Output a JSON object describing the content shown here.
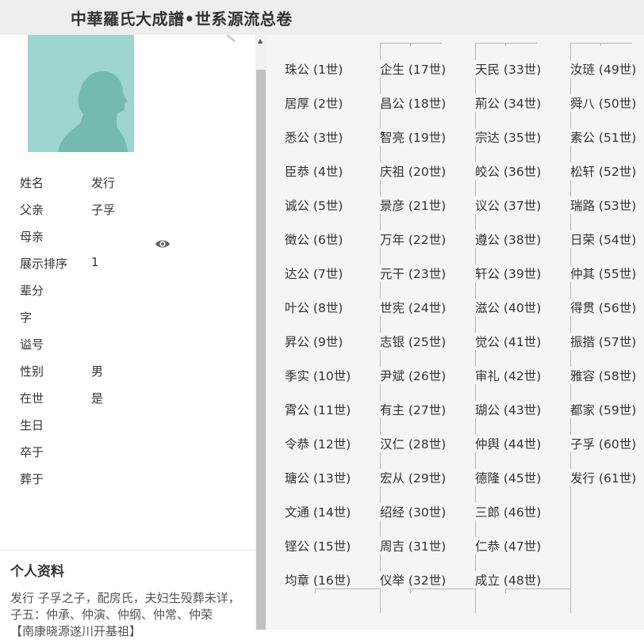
{
  "header": {
    "title": "中華羅氏大成譜•世系源流总卷"
  },
  "profile": {
    "fields": [
      {
        "label": "姓名",
        "value": "发行"
      },
      {
        "label": "父亲",
        "value": "子孚"
      },
      {
        "label": "母亲",
        "value": ""
      },
      {
        "label": "展示排序",
        "value": "1"
      },
      {
        "label": "辈分",
        "value": ""
      },
      {
        "label": "字",
        "value": ""
      },
      {
        "label": "谥号",
        "value": ""
      },
      {
        "label": "性别",
        "value": "男"
      },
      {
        "label": "在世",
        "value": "是"
      },
      {
        "label": "生日",
        "value": ""
      },
      {
        "label": "卒于",
        "value": ""
      },
      {
        "label": "葬于",
        "value": ""
      }
    ],
    "icons": {
      "view": "eye-icon",
      "avatar": "person-silhouette-icon"
    },
    "bio_title": "个人资料",
    "bio_text": "发行  子孚之子，配房氏，夫妇生殁葬未详，子五：仲承、仲演、仲纲、仲常、仲荣",
    "bio_note": "【南康晓源遂川开基祖】"
  },
  "generations": [
    [
      "珠公 (1世)",
      "居厚 (2世)",
      "悉公 (3世)",
      "臣恭 (4世)",
      "诚公 (5世)",
      "徵公 (6世)",
      "达公 (7世)",
      "叶公 (8世)",
      "昇公 (9世)",
      "季实 (10世)",
      "霄公 (11世)",
      "令恭 (12世)",
      "瑭公 (13世)",
      "文通 (14世)",
      "铿公 (15世)",
      "均章 (16世)"
    ],
    [
      "企生 (17世)",
      "昌公 (18世)",
      "智亮 (19世)",
      "庆祖 (20世)",
      "景彦 (21世)",
      "万年 (22世)",
      "元干 (23世)",
      "世宪 (24世)",
      "志银 (25世)",
      "尹斌 (26世)",
      "有主 (27世)",
      "汉仁 (28世)",
      "宏从 (29世)",
      "绍经 (30世)",
      "周吉 (31世)",
      "仪举 (32世)"
    ],
    [
      "天民 (33世)",
      "荊公 (34世)",
      "宗达 (35世)",
      "皎公 (36世)",
      "议公 (37世)",
      "遵公 (38世)",
      "轩公 (39世)",
      "滋公 (40世)",
      "觉公 (41世)",
      "审礼 (42世)",
      "瑚公 (43世)",
      "仲舆 (44世)",
      "德隆 (45世)",
      "三郎 (46世)",
      "仁恭 (47世)",
      "成立 (48世)"
    ],
    [
      "汝琏 (49世)",
      "舜八 (50世)",
      "素公 (51世)",
      "松轩 (52世)",
      "瑞路 (53世)",
      "日荣 (54世)",
      "仲其 (55世)",
      "得贯 (56世)",
      "振揩 (57世)",
      "雅容 (58世)",
      "都家 (59世)",
      "子孚 (60世)",
      "发行 (61世)"
    ]
  ],
  "colors": {
    "header_bg": "#eeeeee",
    "avatar_bg": "#9dd6cf",
    "panel_bg": "#f5f5f5",
    "line": "#b8b8b8"
  }
}
